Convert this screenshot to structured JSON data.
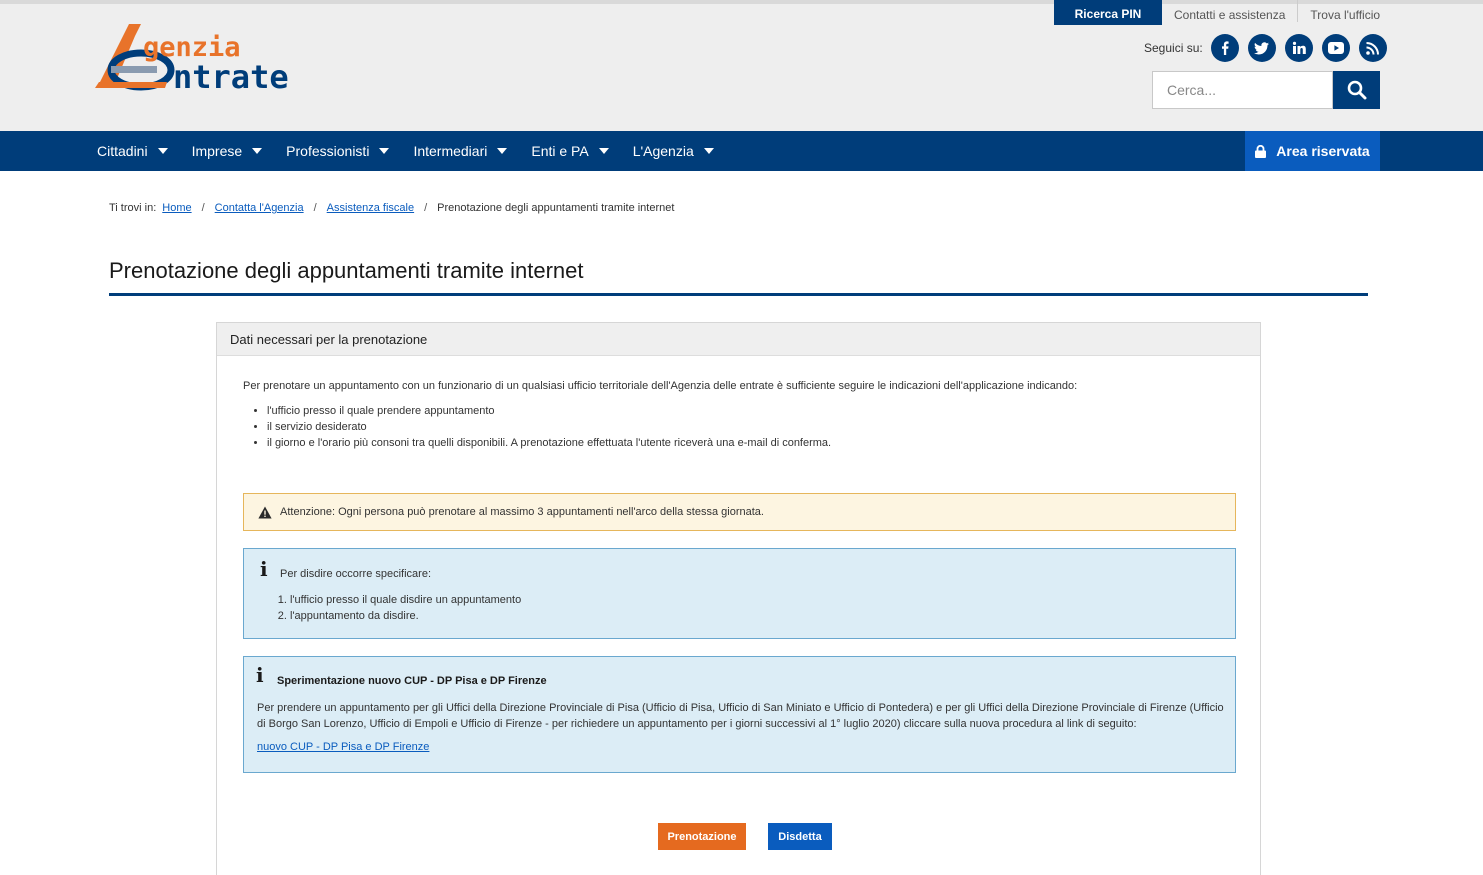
{
  "header": {
    "top_links": [
      "Ricerca PIN",
      "Contatti e assistenza",
      "Trova l'ufficio"
    ],
    "logo": {
      "line1": "genzia",
      "line2": "ntrate"
    },
    "social_label": "Seguici su:",
    "social_icons": [
      "facebook-icon",
      "twitter-icon",
      "linkedin-icon",
      "youtube-icon",
      "rss-icon"
    ],
    "search_placeholder": "Cerca..."
  },
  "nav": {
    "items": [
      "Cittadini",
      "Imprese",
      "Professionisti",
      "Intermediari",
      "Enti e PA",
      "L'Agenzia"
    ],
    "area_riservata": "Area riservata"
  },
  "breadcrumb": {
    "prefix": "Ti trovi in:",
    "links": [
      "Home",
      "Contatta l'Agenzia",
      "Assistenza fiscale"
    ],
    "current": "Prenotazione degli appuntamenti tramite internet",
    "separator": "/"
  },
  "page_title": "Prenotazione degli appuntamenti tramite internet",
  "panel": {
    "title": "Dati necessari per la prenotazione",
    "intro": "Per prenotare un appuntamento con un funzionario di un qualsiasi ufficio territoriale dell'Agenzia delle entrate è sufficiente seguire le indicazioni dell'applicazione indicando:",
    "bullets": [
      "l'ufficio presso il quale prendere appuntamento",
      "il servizio desiderato",
      "il giorno e l'orario più consoni tra quelli disponibili. A prenotazione effettuata l'utente riceverà una e-mail di conferma."
    ],
    "warning": "Attenzione: Ogni persona può prenotare al massimo 3 appuntamenti nell'arco della stessa giornata.",
    "info1": {
      "lead": "Per disdire occorre specificare:",
      "items": [
        "l'ufficio presso il quale disdire un appuntamento",
        "l'appuntamento da disdire."
      ]
    },
    "info2": {
      "title": "Sperimentazione nuovo CUP - DP Pisa e DP Firenze",
      "body": "Per prendere un appuntamento per gli Uffici della Direzione Provinciale di Pisa (Ufficio di Pisa, Ufficio di San Miniato e Ufficio di Pontedera) e per gli Uffici della Direzione Provinciale di Firenze (Ufficio di Borgo San Lorenzo, Ufficio di Empoli e Ufficio di Firenze - per richiedere un appuntamento per i giorni successivi al 1° luglio 2020) cliccare sulla nuova procedura al link di seguito:",
      "link": "nuovo CUP - DP Pisa e DP Firenze"
    },
    "buttons": {
      "prenotazione": "Prenotazione",
      "disdetta": "Disdetta"
    }
  },
  "colors": {
    "brand_blue": "#003d7a",
    "accent_blue": "#0a5cbe",
    "brand_orange": "#e56a1f",
    "info_bg": "#dcedf6",
    "warning_bg": "#fdf5e1"
  }
}
